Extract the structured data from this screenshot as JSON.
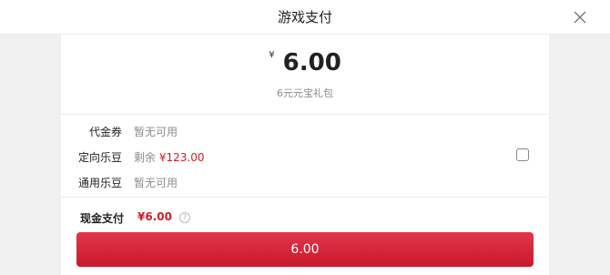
{
  "header": {
    "title": "游戏支付"
  },
  "summary": {
    "currency_symbol": "¥",
    "amount": "6.00",
    "product": "6元元宝礼包"
  },
  "rows": [
    {
      "label": "代金券",
      "value": "暂无可用"
    },
    {
      "label": "定向乐豆",
      "value_prefix": "剩余",
      "value_amount": "¥123.00"
    },
    {
      "label": "通用乐豆",
      "value": "暂无可用"
    }
  ],
  "cash": {
    "label": "现金支付",
    "amount": "¥6.00",
    "help": "?"
  },
  "button": {
    "label": "6.00"
  },
  "colors": {
    "accent": "#cc1f2a",
    "button_top": "#e3364a",
    "button_bottom": "#c8192b",
    "background": "#f0f0f0"
  },
  "icons": {
    "close": "close-icon",
    "help": "help-icon"
  }
}
